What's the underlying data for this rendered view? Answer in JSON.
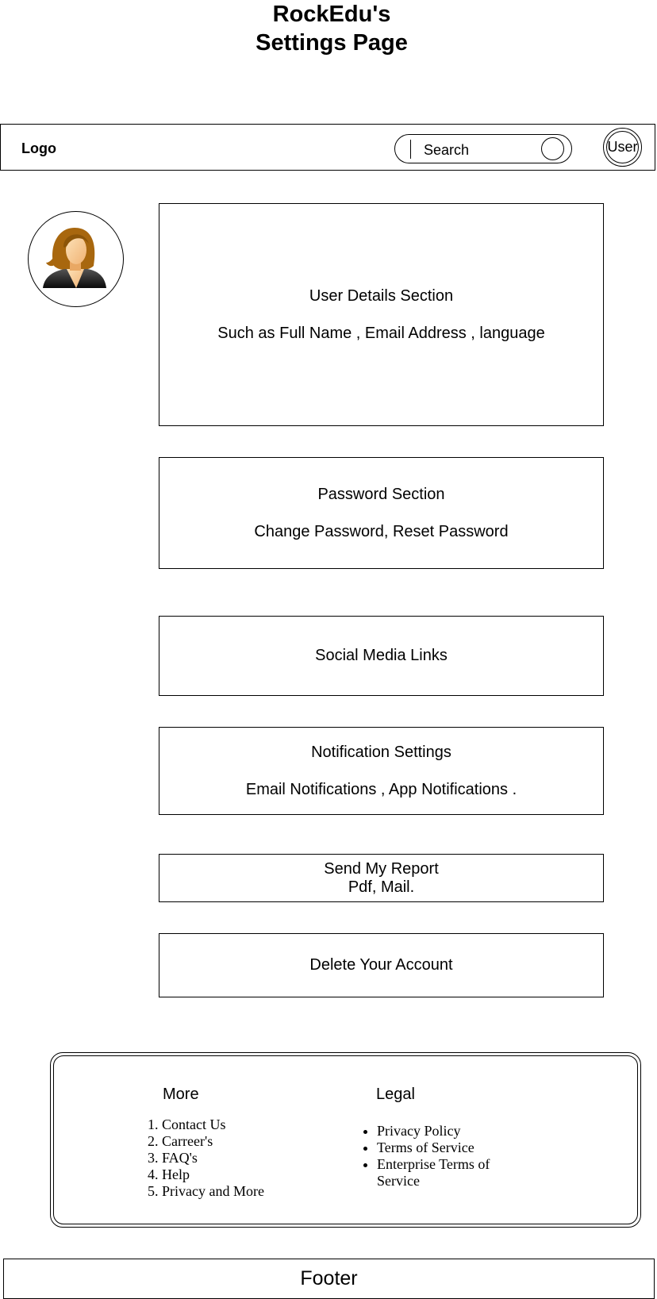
{
  "page": {
    "title_line1": "RockEdu's",
    "title_line2": "Settings Page"
  },
  "header": {
    "logo": "Logo",
    "search_label": "Search",
    "user_label": "User"
  },
  "sections": {
    "user_details": {
      "title": "User Details Section",
      "detail": "Such as Full Name , Email Address , language"
    },
    "password": {
      "title": "Password Section",
      "detail": "Change Password, Reset Password"
    },
    "social": {
      "title": "Social Media Links"
    },
    "notifications": {
      "title": "Notification Settings",
      "detail": "Email Notifications , App Notifications ."
    },
    "report": {
      "title": "Send My Report",
      "detail": "Pdf, Mail."
    },
    "delete": {
      "title": "Delete Your Account"
    }
  },
  "footer_panel": {
    "more": {
      "title": "More",
      "items": [
        "Contact Us",
        "Carreer's",
        "FAQ's",
        "Help",
        "Privacy and More"
      ]
    },
    "legal": {
      "title": "Legal",
      "items": [
        "Privacy Policy",
        "Terms of Service",
        "Enterprise Terms of Service"
      ]
    }
  },
  "footer": {
    "label": "Footer"
  },
  "colors": {
    "border": "#000000",
    "background": "#ffffff",
    "avatar_hair": "#a8670e",
    "avatar_skin": "#f7c98e",
    "avatar_suit": "#1a1a1a"
  }
}
